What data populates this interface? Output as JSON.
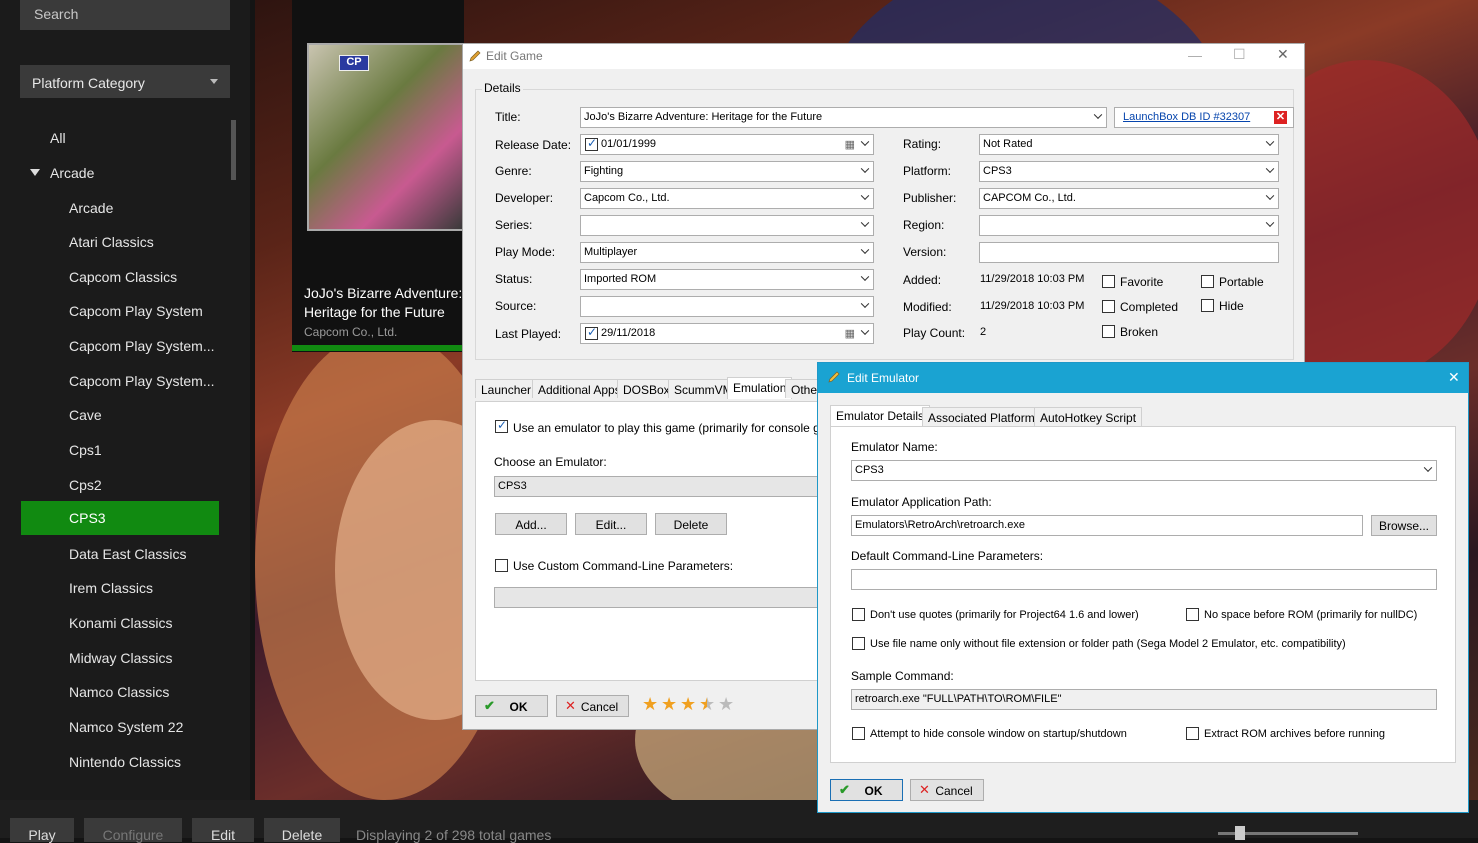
{
  "sidebar": {
    "search_placeholder": "Search",
    "category_label": "Platform Category",
    "items": [
      {
        "label": "All",
        "selected": false
      },
      {
        "label": "Arcade",
        "selected": false
      },
      {
        "label": "Arcade",
        "selected": false
      },
      {
        "label": "Atari Classics",
        "selected": false
      },
      {
        "label": "Capcom Classics",
        "selected": false
      },
      {
        "label": "Capcom Play System",
        "selected": false
      },
      {
        "label": "Capcom Play System...",
        "selected": false
      },
      {
        "label": "Capcom Play System...",
        "selected": false
      },
      {
        "label": "Cave",
        "selected": false
      },
      {
        "label": "Cps1",
        "selected": false
      },
      {
        "label": "Cps2",
        "selected": false
      },
      {
        "label": "CPS3",
        "selected": true
      },
      {
        "label": "Data East Classics",
        "selected": false
      },
      {
        "label": "Irem Classics",
        "selected": false
      },
      {
        "label": "Konami Classics",
        "selected": false
      },
      {
        "label": "Midway Classics",
        "selected": false
      },
      {
        "label": "Namco Classics",
        "selected": false
      },
      {
        "label": "Namco System 22",
        "selected": false
      },
      {
        "label": "Nintendo Classics",
        "selected": false
      }
    ]
  },
  "game_tile": {
    "cover_badge": "CP",
    "title": "JoJo's Bizarre Adventure: Heritage for the Future",
    "developer": "Capcom Co., Ltd."
  },
  "bottombar": {
    "play": "Play",
    "configure": "Configure",
    "edit": "Edit",
    "delete": "Delete",
    "status": "Displaying 2 of 298 total games"
  },
  "edit_game": {
    "window_title": "Edit Game",
    "details_label": "Details",
    "labels": {
      "title": "Title:",
      "release_date": "Release Date:",
      "genre": "Genre:",
      "developer": "Developer:",
      "series": "Series:",
      "play_mode": "Play Mode:",
      "status": "Status:",
      "source": "Source:",
      "last_played": "Last Played:",
      "rating": "Rating:",
      "platform": "Platform:",
      "publisher": "Publisher:",
      "region": "Region:",
      "version": "Version:",
      "added": "Added:",
      "modified": "Modified:",
      "play_count": "Play Count:"
    },
    "values": {
      "title": "JoJo's Bizarre Adventure: Heritage for the Future",
      "db_link": "LaunchBox DB ID #32307",
      "release_date": "01/01/1999",
      "genre": "Fighting",
      "developer": "Capcom Co., Ltd.",
      "series": "",
      "play_mode": "Multiplayer",
      "status": "Imported ROM",
      "source": "",
      "last_played": "29/11/2018",
      "rating": "Not Rated",
      "platform": "CPS3",
      "publisher": "CAPCOM Co., Ltd.",
      "region": "",
      "version": "",
      "added": "11/29/2018 10:03 PM",
      "modified": "11/29/2018 10:03 PM",
      "play_count": "2"
    },
    "flags": {
      "favorite": "Favorite",
      "portable": "Portable",
      "completed": "Completed",
      "hide": "Hide",
      "broken": "Broken"
    },
    "tabs": [
      "Launcher",
      "Additional Apps",
      "DOSBox",
      "ScummVM",
      "Emulation",
      "Other"
    ],
    "emulation": {
      "use_emulator": "Use an emulator to play this game (primarily for console games)",
      "choose_label": "Choose an Emulator:",
      "selected_emulator": "CPS3",
      "add": "Add...",
      "edit": "Edit...",
      "delete": "Delete",
      "custom_params": "Use Custom Command-Line Parameters:"
    },
    "ok": "OK",
    "cancel": "Cancel",
    "star_rating": 3.5
  },
  "edit_emulator": {
    "window_title": "Edit Emulator",
    "tabs": [
      "Emulator Details",
      "Associated Platforms",
      "AutoHotkey Script"
    ],
    "name_label": "Emulator Name:",
    "name_value": "CPS3",
    "path_label": "Emulator Application Path:",
    "path_value": "Emulators\\RetroArch\\retroarch.exe",
    "browse": "Browse...",
    "params_label": "Default Command-Line Parameters:",
    "params_value": "",
    "no_quotes": "Don't use quotes (primarily for Project64 1.6 and lower)",
    "no_space": "No space before ROM (primarily for nullDC)",
    "filename_only": "Use file name only without file extension or folder path (Sega Model 2 Emulator, etc. compatibility)",
    "sample_label": "Sample Command:",
    "sample_value": "retroarch.exe \"FULL\\PATH\\TO\\ROM\\FILE\"",
    "hide_console": "Attempt to hide console window on startup/shutdown",
    "extract_rom": "Extract ROM archives before running",
    "ok": "OK",
    "cancel": "Cancel"
  },
  "colors": {
    "selection_green": "#118a11",
    "emulator_titlebar": "#1aa3d2"
  }
}
